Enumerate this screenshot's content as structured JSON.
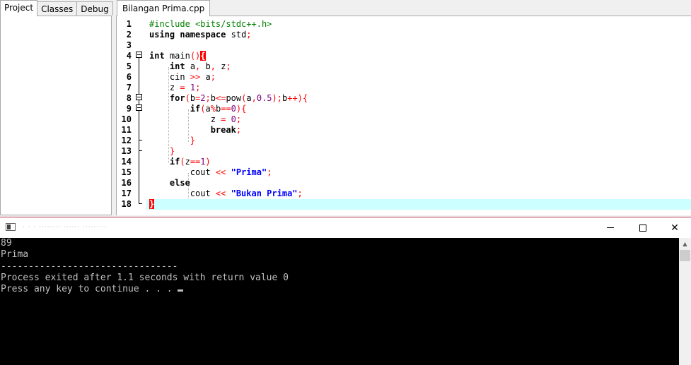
{
  "left_tabs": [
    "Project",
    "Classes",
    "Debug"
  ],
  "file_tab": "Bilangan Prima.cpp",
  "line_numbers": [
    "1",
    "2",
    "3",
    "4",
    "5",
    "6",
    "7",
    "8",
    "9",
    "10",
    "11",
    "12",
    "13",
    "14",
    "15",
    "16",
    "17",
    "18"
  ],
  "console": {
    "title": "· · ·   ········ ······ ·········",
    "output": [
      "89",
      "Prima",
      "--------------------------------",
      "Process exited after 1.1 seconds with return value 0",
      "Press any key to continue . . . "
    ]
  },
  "colors": {
    "keyword": "#000000",
    "operator": "#ff0000",
    "number": "#800080",
    "string": "#0000ff",
    "preprocessor": "#008000",
    "current_line": "#ccffff",
    "brace_highlight": "#ff0000"
  },
  "icons": {
    "fold": "fold-minus-icon",
    "minimize": "minimize-icon",
    "maximize": "maximize-icon",
    "close": "close-icon",
    "console_app": "console-app-icon"
  }
}
